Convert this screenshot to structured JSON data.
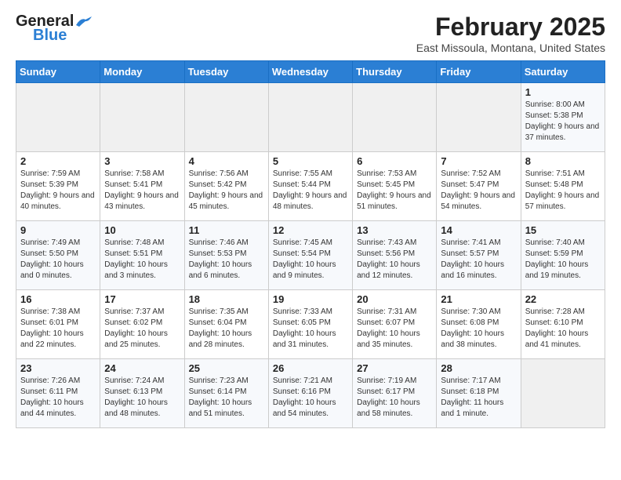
{
  "logo": {
    "part1": "General",
    "part2": "Blue"
  },
  "title": "February 2025",
  "location": "East Missoula, Montana, United States",
  "weekdays": [
    "Sunday",
    "Monday",
    "Tuesday",
    "Wednesday",
    "Thursday",
    "Friday",
    "Saturday"
  ],
  "weeks": [
    [
      {
        "day": "",
        "info": ""
      },
      {
        "day": "",
        "info": ""
      },
      {
        "day": "",
        "info": ""
      },
      {
        "day": "",
        "info": ""
      },
      {
        "day": "",
        "info": ""
      },
      {
        "day": "",
        "info": ""
      },
      {
        "day": "1",
        "info": "Sunrise: 8:00 AM\nSunset: 5:38 PM\nDaylight: 9 hours and 37 minutes."
      }
    ],
    [
      {
        "day": "2",
        "info": "Sunrise: 7:59 AM\nSunset: 5:39 PM\nDaylight: 9 hours and 40 minutes."
      },
      {
        "day": "3",
        "info": "Sunrise: 7:58 AM\nSunset: 5:41 PM\nDaylight: 9 hours and 43 minutes."
      },
      {
        "day": "4",
        "info": "Sunrise: 7:56 AM\nSunset: 5:42 PM\nDaylight: 9 hours and 45 minutes."
      },
      {
        "day": "5",
        "info": "Sunrise: 7:55 AM\nSunset: 5:44 PM\nDaylight: 9 hours and 48 minutes."
      },
      {
        "day": "6",
        "info": "Sunrise: 7:53 AM\nSunset: 5:45 PM\nDaylight: 9 hours and 51 minutes."
      },
      {
        "day": "7",
        "info": "Sunrise: 7:52 AM\nSunset: 5:47 PM\nDaylight: 9 hours and 54 minutes."
      },
      {
        "day": "8",
        "info": "Sunrise: 7:51 AM\nSunset: 5:48 PM\nDaylight: 9 hours and 57 minutes."
      }
    ],
    [
      {
        "day": "9",
        "info": "Sunrise: 7:49 AM\nSunset: 5:50 PM\nDaylight: 10 hours and 0 minutes."
      },
      {
        "day": "10",
        "info": "Sunrise: 7:48 AM\nSunset: 5:51 PM\nDaylight: 10 hours and 3 minutes."
      },
      {
        "day": "11",
        "info": "Sunrise: 7:46 AM\nSunset: 5:53 PM\nDaylight: 10 hours and 6 minutes."
      },
      {
        "day": "12",
        "info": "Sunrise: 7:45 AM\nSunset: 5:54 PM\nDaylight: 10 hours and 9 minutes."
      },
      {
        "day": "13",
        "info": "Sunrise: 7:43 AM\nSunset: 5:56 PM\nDaylight: 10 hours and 12 minutes."
      },
      {
        "day": "14",
        "info": "Sunrise: 7:41 AM\nSunset: 5:57 PM\nDaylight: 10 hours and 16 minutes."
      },
      {
        "day": "15",
        "info": "Sunrise: 7:40 AM\nSunset: 5:59 PM\nDaylight: 10 hours and 19 minutes."
      }
    ],
    [
      {
        "day": "16",
        "info": "Sunrise: 7:38 AM\nSunset: 6:01 PM\nDaylight: 10 hours and 22 minutes."
      },
      {
        "day": "17",
        "info": "Sunrise: 7:37 AM\nSunset: 6:02 PM\nDaylight: 10 hours and 25 minutes."
      },
      {
        "day": "18",
        "info": "Sunrise: 7:35 AM\nSunset: 6:04 PM\nDaylight: 10 hours and 28 minutes."
      },
      {
        "day": "19",
        "info": "Sunrise: 7:33 AM\nSunset: 6:05 PM\nDaylight: 10 hours and 31 minutes."
      },
      {
        "day": "20",
        "info": "Sunrise: 7:31 AM\nSunset: 6:07 PM\nDaylight: 10 hours and 35 minutes."
      },
      {
        "day": "21",
        "info": "Sunrise: 7:30 AM\nSunset: 6:08 PM\nDaylight: 10 hours and 38 minutes."
      },
      {
        "day": "22",
        "info": "Sunrise: 7:28 AM\nSunset: 6:10 PM\nDaylight: 10 hours and 41 minutes."
      }
    ],
    [
      {
        "day": "23",
        "info": "Sunrise: 7:26 AM\nSunset: 6:11 PM\nDaylight: 10 hours and 44 minutes."
      },
      {
        "day": "24",
        "info": "Sunrise: 7:24 AM\nSunset: 6:13 PM\nDaylight: 10 hours and 48 minutes."
      },
      {
        "day": "25",
        "info": "Sunrise: 7:23 AM\nSunset: 6:14 PM\nDaylight: 10 hours and 51 minutes."
      },
      {
        "day": "26",
        "info": "Sunrise: 7:21 AM\nSunset: 6:16 PM\nDaylight: 10 hours and 54 minutes."
      },
      {
        "day": "27",
        "info": "Sunrise: 7:19 AM\nSunset: 6:17 PM\nDaylight: 10 hours and 58 minutes."
      },
      {
        "day": "28",
        "info": "Sunrise: 7:17 AM\nSunset: 6:18 PM\nDaylight: 11 hours and 1 minute."
      },
      {
        "day": "",
        "info": ""
      }
    ]
  ]
}
